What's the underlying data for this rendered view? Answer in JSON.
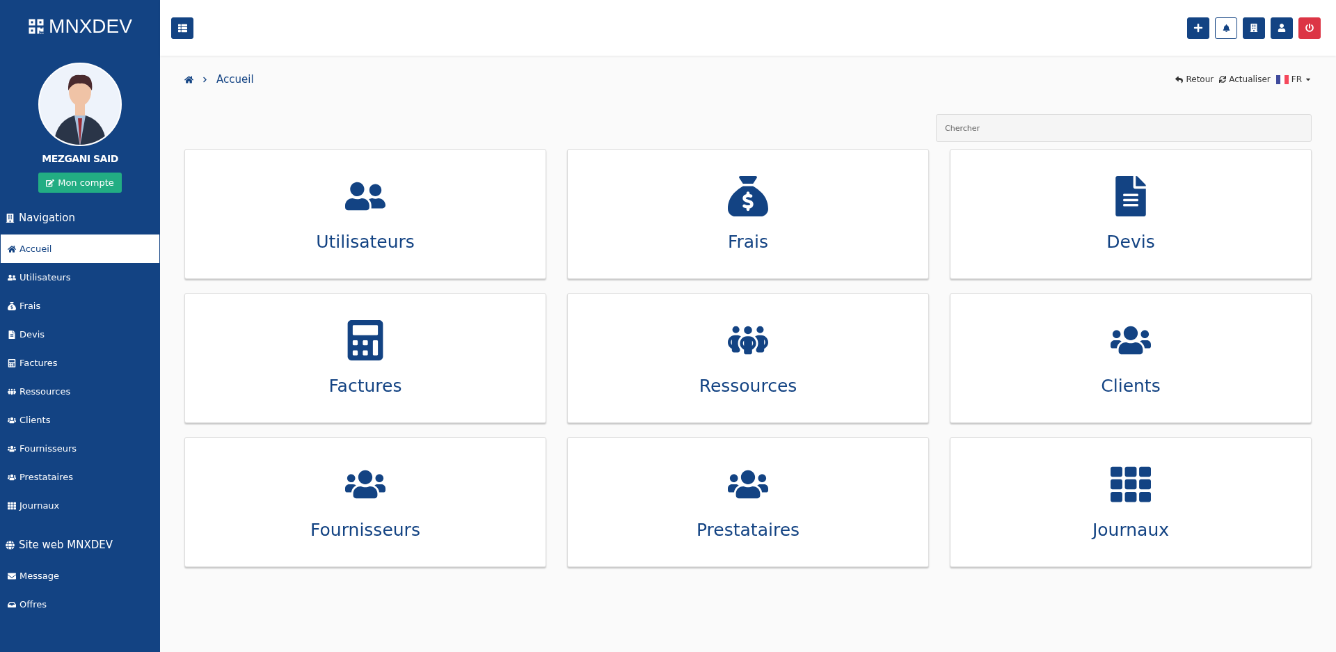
{
  "brand": "MNXDEV",
  "user": {
    "name": "MEZGANI SAID",
    "account_button": "Mon compte"
  },
  "sidebar": {
    "sections": [
      {
        "title": "Navigation",
        "items": [
          {
            "label": "Accueil",
            "selected": true
          },
          {
            "label": "Utilisateurs",
            "selected": false
          },
          {
            "label": "Frais",
            "selected": false
          },
          {
            "label": "Devis",
            "selected": false
          },
          {
            "label": "Factures",
            "selected": false
          },
          {
            "label": "Ressources",
            "selected": false
          },
          {
            "label": "Clients",
            "selected": false
          },
          {
            "label": "Fournisseurs",
            "selected": false
          },
          {
            "label": "Prestataires",
            "selected": false
          },
          {
            "label": "Journaux",
            "selected": false
          }
        ]
      },
      {
        "title": "Site web MNXDEV",
        "items": [
          {
            "label": "Message",
            "selected": false
          },
          {
            "label": "Offres",
            "selected": false
          }
        ]
      }
    ]
  },
  "breadcrumb": {
    "current": "Accueil"
  },
  "actions": {
    "back": "Retour",
    "refresh": "Actualiser",
    "language": "FR"
  },
  "search": {
    "placeholder": "Chercher"
  },
  "cards": [
    {
      "label": "Utilisateurs"
    },
    {
      "label": "Frais"
    },
    {
      "label": "Devis"
    },
    {
      "label": "Factures"
    },
    {
      "label": "Ressources"
    },
    {
      "label": "Clients"
    },
    {
      "label": "Fournisseurs"
    },
    {
      "label": "Prestataires"
    },
    {
      "label": "Journaux"
    }
  ]
}
